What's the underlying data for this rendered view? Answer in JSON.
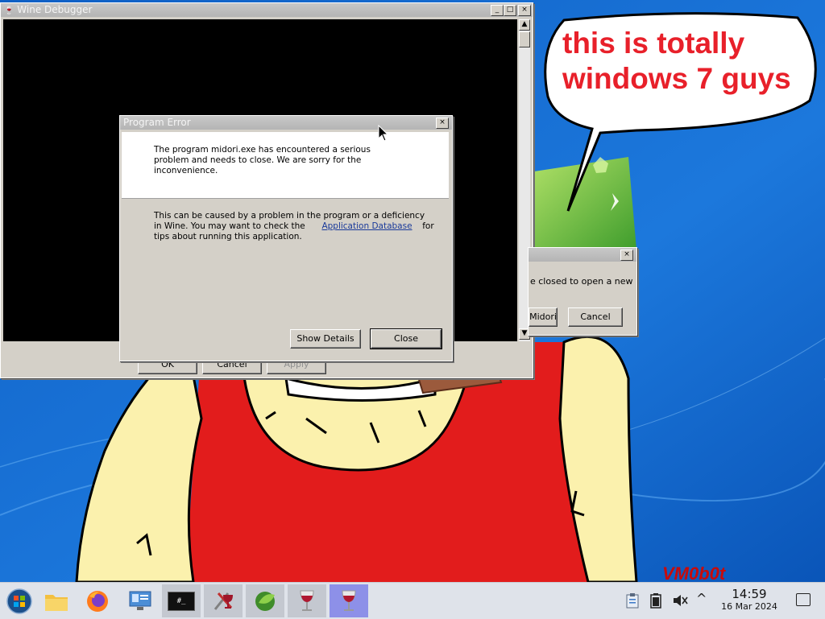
{
  "desktop": {
    "speech_bubble_text_line1": "this is totally",
    "speech_bubble_text_line2": "windows 7 guys",
    "signature": "VM0b0t"
  },
  "wine_debugger": {
    "title": "Wine Debugger",
    "min_label": "_",
    "max_label": "□",
    "close_label": "×",
    "ok_label": "OK",
    "cancel_label": "Cancel",
    "apply_label": "Apply"
  },
  "bg_dialog": {
    "message_fragment": "e closed to open a new",
    "midori_label": "Midori",
    "cancel_label": "Cancel",
    "close_label": "×"
  },
  "error_dialog": {
    "title": "Program Error",
    "close_label": "×",
    "message": "The program midori.exe has encountered a serious problem and needs to close. We are sorry for the inconvenience.",
    "detail_line1": "This can be caused by a problem in the program or a deficiency",
    "detail_line2_prefix": "in Wine. You may want to check the",
    "link_text": "Application Database",
    "detail_line2_suffix": "for",
    "detail_line3": "tips about running this application.",
    "show_details_label": "Show Details",
    "close_button_label": "Close"
  },
  "taskbar": {
    "items": [
      {
        "icon": "start-orb-icon"
      },
      {
        "icon": "file-manager-icon"
      },
      {
        "icon": "firefox-icon"
      },
      {
        "icon": "control-panel-icon"
      },
      {
        "icon": "terminal-icon",
        "text": "#_"
      },
      {
        "icon": "wine-tools-icon"
      },
      {
        "icon": "midori-icon"
      },
      {
        "icon": "wine-glass-icon"
      },
      {
        "icon": "wine-glass-icon"
      }
    ],
    "clock_time": "14:59",
    "clock_date": "16 Mar 2024",
    "tray_arrow": "^"
  },
  "colors": {
    "desktop_blue": "#1a6fd0",
    "bubble_text": "#e8202a",
    "shirt_red": "#e21c1c",
    "skin": "#fbf1ad",
    "link": "#1a3a9a"
  }
}
